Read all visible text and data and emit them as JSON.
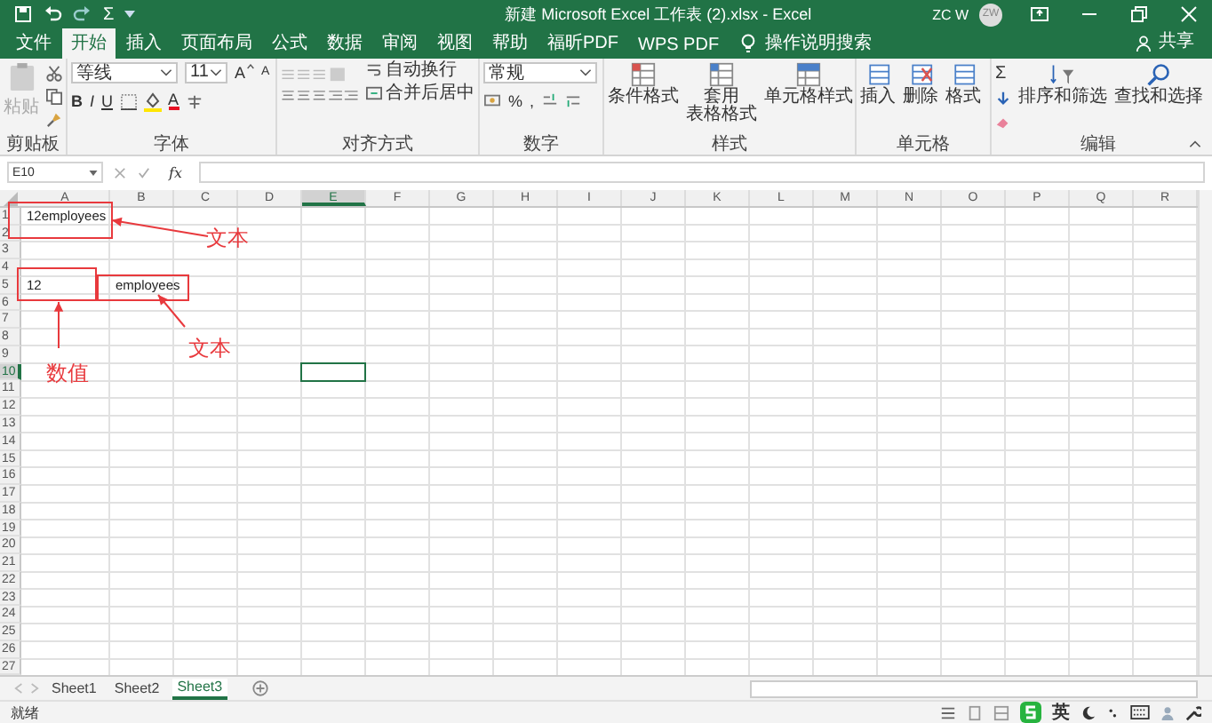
{
  "title_bar": {
    "quick_sum": "Σ",
    "title": "新建 Microsoft Excel 工作表 (2).xlsx  -  Excel",
    "user": "ZC W",
    "avatar": "ZW"
  },
  "tabs": [
    {
      "label": "文件",
      "selected": false
    },
    {
      "label": "开始",
      "selected": true
    },
    {
      "label": "插入",
      "selected": false
    },
    {
      "label": "页面布局",
      "selected": false
    },
    {
      "label": "公式",
      "selected": false
    },
    {
      "label": "数据",
      "selected": false
    },
    {
      "label": "审阅",
      "selected": false
    },
    {
      "label": "视图",
      "selected": false
    },
    {
      "label": "帮助",
      "selected": false
    },
    {
      "label": "福昕PDF",
      "selected": false
    },
    {
      "label": "WPS PDF",
      "selected": false
    }
  ],
  "tell_me": "操作说明搜索",
  "share": "共享",
  "ribbon": {
    "clipboard": {
      "paste": "粘贴",
      "label": "剪贴板"
    },
    "font": {
      "name": "等线",
      "size": "11",
      "grow": "A",
      "shrink": "A",
      "styles": [
        "B",
        "I",
        "U"
      ],
      "color_letter": "A",
      "label": "字体"
    },
    "alignment": {
      "wrap": "自动换行",
      "merge": "合并后居中",
      "label": "对齐方式"
    },
    "number": {
      "format": "常规",
      "percent": "%",
      "comma": ",",
      "label": "数字"
    },
    "styles": {
      "buttons": [
        {
          "lines": [
            "条件格式"
          ]
        },
        {
          "lines": [
            "套用",
            "表格格式"
          ]
        },
        {
          "lines": [
            "单元格样式"
          ]
        }
      ],
      "label": "样式"
    },
    "cells": {
      "buttons": [
        "插入",
        "删除",
        "格式"
      ],
      "label": "单元格"
    },
    "editing": {
      "sum": "Σ",
      "sort": "排序和筛选",
      "find": "查找和选择",
      "label": "编辑"
    }
  },
  "formula_bar": {
    "name_box": "E10",
    "fx": "fx"
  },
  "columns": [
    {
      "label": "A",
      "selected": false
    },
    {
      "label": "B",
      "selected": false
    },
    {
      "label": "C",
      "selected": false
    },
    {
      "label": "D",
      "selected": false
    },
    {
      "label": "E",
      "selected": true
    },
    {
      "label": "F",
      "selected": false
    },
    {
      "label": "G",
      "selected": false
    },
    {
      "label": "H",
      "selected": false
    },
    {
      "label": "I",
      "selected": false
    },
    {
      "label": "J",
      "selected": false
    },
    {
      "label": "K",
      "selected": false
    },
    {
      "label": "L",
      "selected": false
    },
    {
      "label": "M",
      "selected": false
    },
    {
      "label": "N",
      "selected": false
    },
    {
      "label": "O",
      "selected": false
    },
    {
      "label": "P",
      "selected": false
    },
    {
      "label": "Q",
      "selected": false
    },
    {
      "label": "R",
      "selected": false
    }
  ],
  "rows": [
    {
      "label": "1",
      "selected": false,
      "cells": [
        "12employees"
      ]
    },
    {
      "label": "2",
      "selected": false
    },
    {
      "label": "3",
      "selected": false
    },
    {
      "label": "4",
      "selected": false
    },
    {
      "label": "5",
      "selected": false,
      "cells": [
        "12",
        "employees"
      ]
    },
    {
      "label": "6",
      "selected": false
    },
    {
      "label": "7",
      "selected": false
    },
    {
      "label": "8",
      "selected": false
    },
    {
      "label": "9",
      "selected": false
    },
    {
      "label": "10",
      "selected": true
    },
    {
      "label": "11",
      "selected": false
    },
    {
      "label": "12",
      "selected": false
    },
    {
      "label": "13",
      "selected": false
    },
    {
      "label": "14",
      "selected": false
    },
    {
      "label": "15",
      "selected": false
    },
    {
      "label": "16",
      "selected": false
    },
    {
      "label": "17",
      "selected": false
    },
    {
      "label": "18",
      "selected": false
    },
    {
      "label": "19",
      "selected": false
    },
    {
      "label": "20",
      "selected": false
    },
    {
      "label": "21",
      "selected": false
    },
    {
      "label": "22",
      "selected": false
    },
    {
      "label": "23",
      "selected": false
    },
    {
      "label": "24",
      "selected": false
    },
    {
      "label": "25",
      "selected": false
    },
    {
      "label": "26",
      "selected": false
    },
    {
      "label": "27",
      "selected": false
    }
  ],
  "annotations": [
    {
      "text": "文本"
    },
    {
      "text": "数值"
    },
    {
      "text": "文本"
    }
  ],
  "sheet_tabs": [
    {
      "label": "Sheet1",
      "selected": false
    },
    {
      "label": "Sheet2",
      "selected": false
    },
    {
      "label": "Sheet3",
      "selected": true
    }
  ],
  "status_bar": {
    "text": "就绪",
    "ime": "英"
  }
}
